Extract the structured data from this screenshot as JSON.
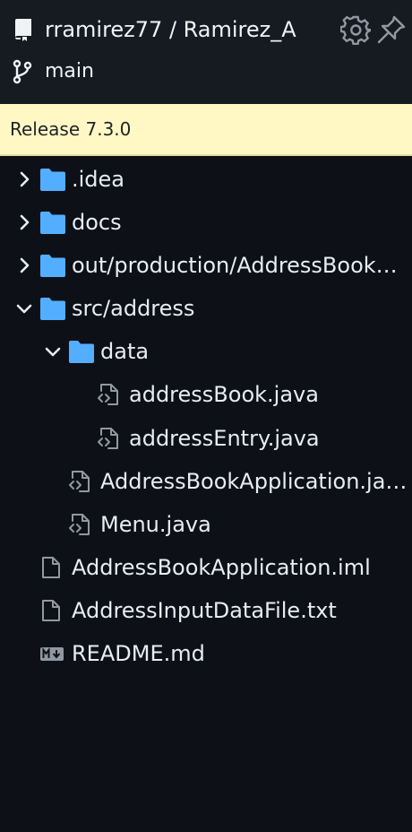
{
  "header": {
    "repo_title": "rramirez77 / Ramirez_A",
    "branch": "main",
    "icons": [
      "repo-icon",
      "gear-icon",
      "pin-icon",
      "branch-icon"
    ]
  },
  "release": {
    "label": "Release 7.3.0"
  },
  "tree": {
    "items": [
      {
        "label": ".idea",
        "type": "folder",
        "expanded": false
      },
      {
        "label": "docs",
        "type": "folder",
        "expanded": false
      },
      {
        "label": "out/production/AddressBookApplication",
        "type": "folder",
        "expanded": false
      },
      {
        "label": "src/address",
        "type": "folder",
        "expanded": true
      },
      {
        "label": "data",
        "type": "folder",
        "expanded": true
      },
      {
        "label": "addressBook.java",
        "type": "code-file"
      },
      {
        "label": "addressEntry.java",
        "type": "code-file"
      },
      {
        "label": "AddressBookApplication.java",
        "type": "code-file"
      },
      {
        "label": "Menu.java",
        "type": "code-file"
      },
      {
        "label": "AddressBookApplication.iml",
        "type": "file"
      },
      {
        "label": "AddressInputDataFile.txt",
        "type": "file"
      },
      {
        "label": "README.md",
        "type": "markdown-file"
      }
    ]
  },
  "colors": {
    "background": "#0d1117",
    "header_bg": "#161b22",
    "folder": "#54aeff",
    "release_bg": "#fff8c5",
    "text": "#e6edf3",
    "icon_gray": "#9198a1"
  }
}
